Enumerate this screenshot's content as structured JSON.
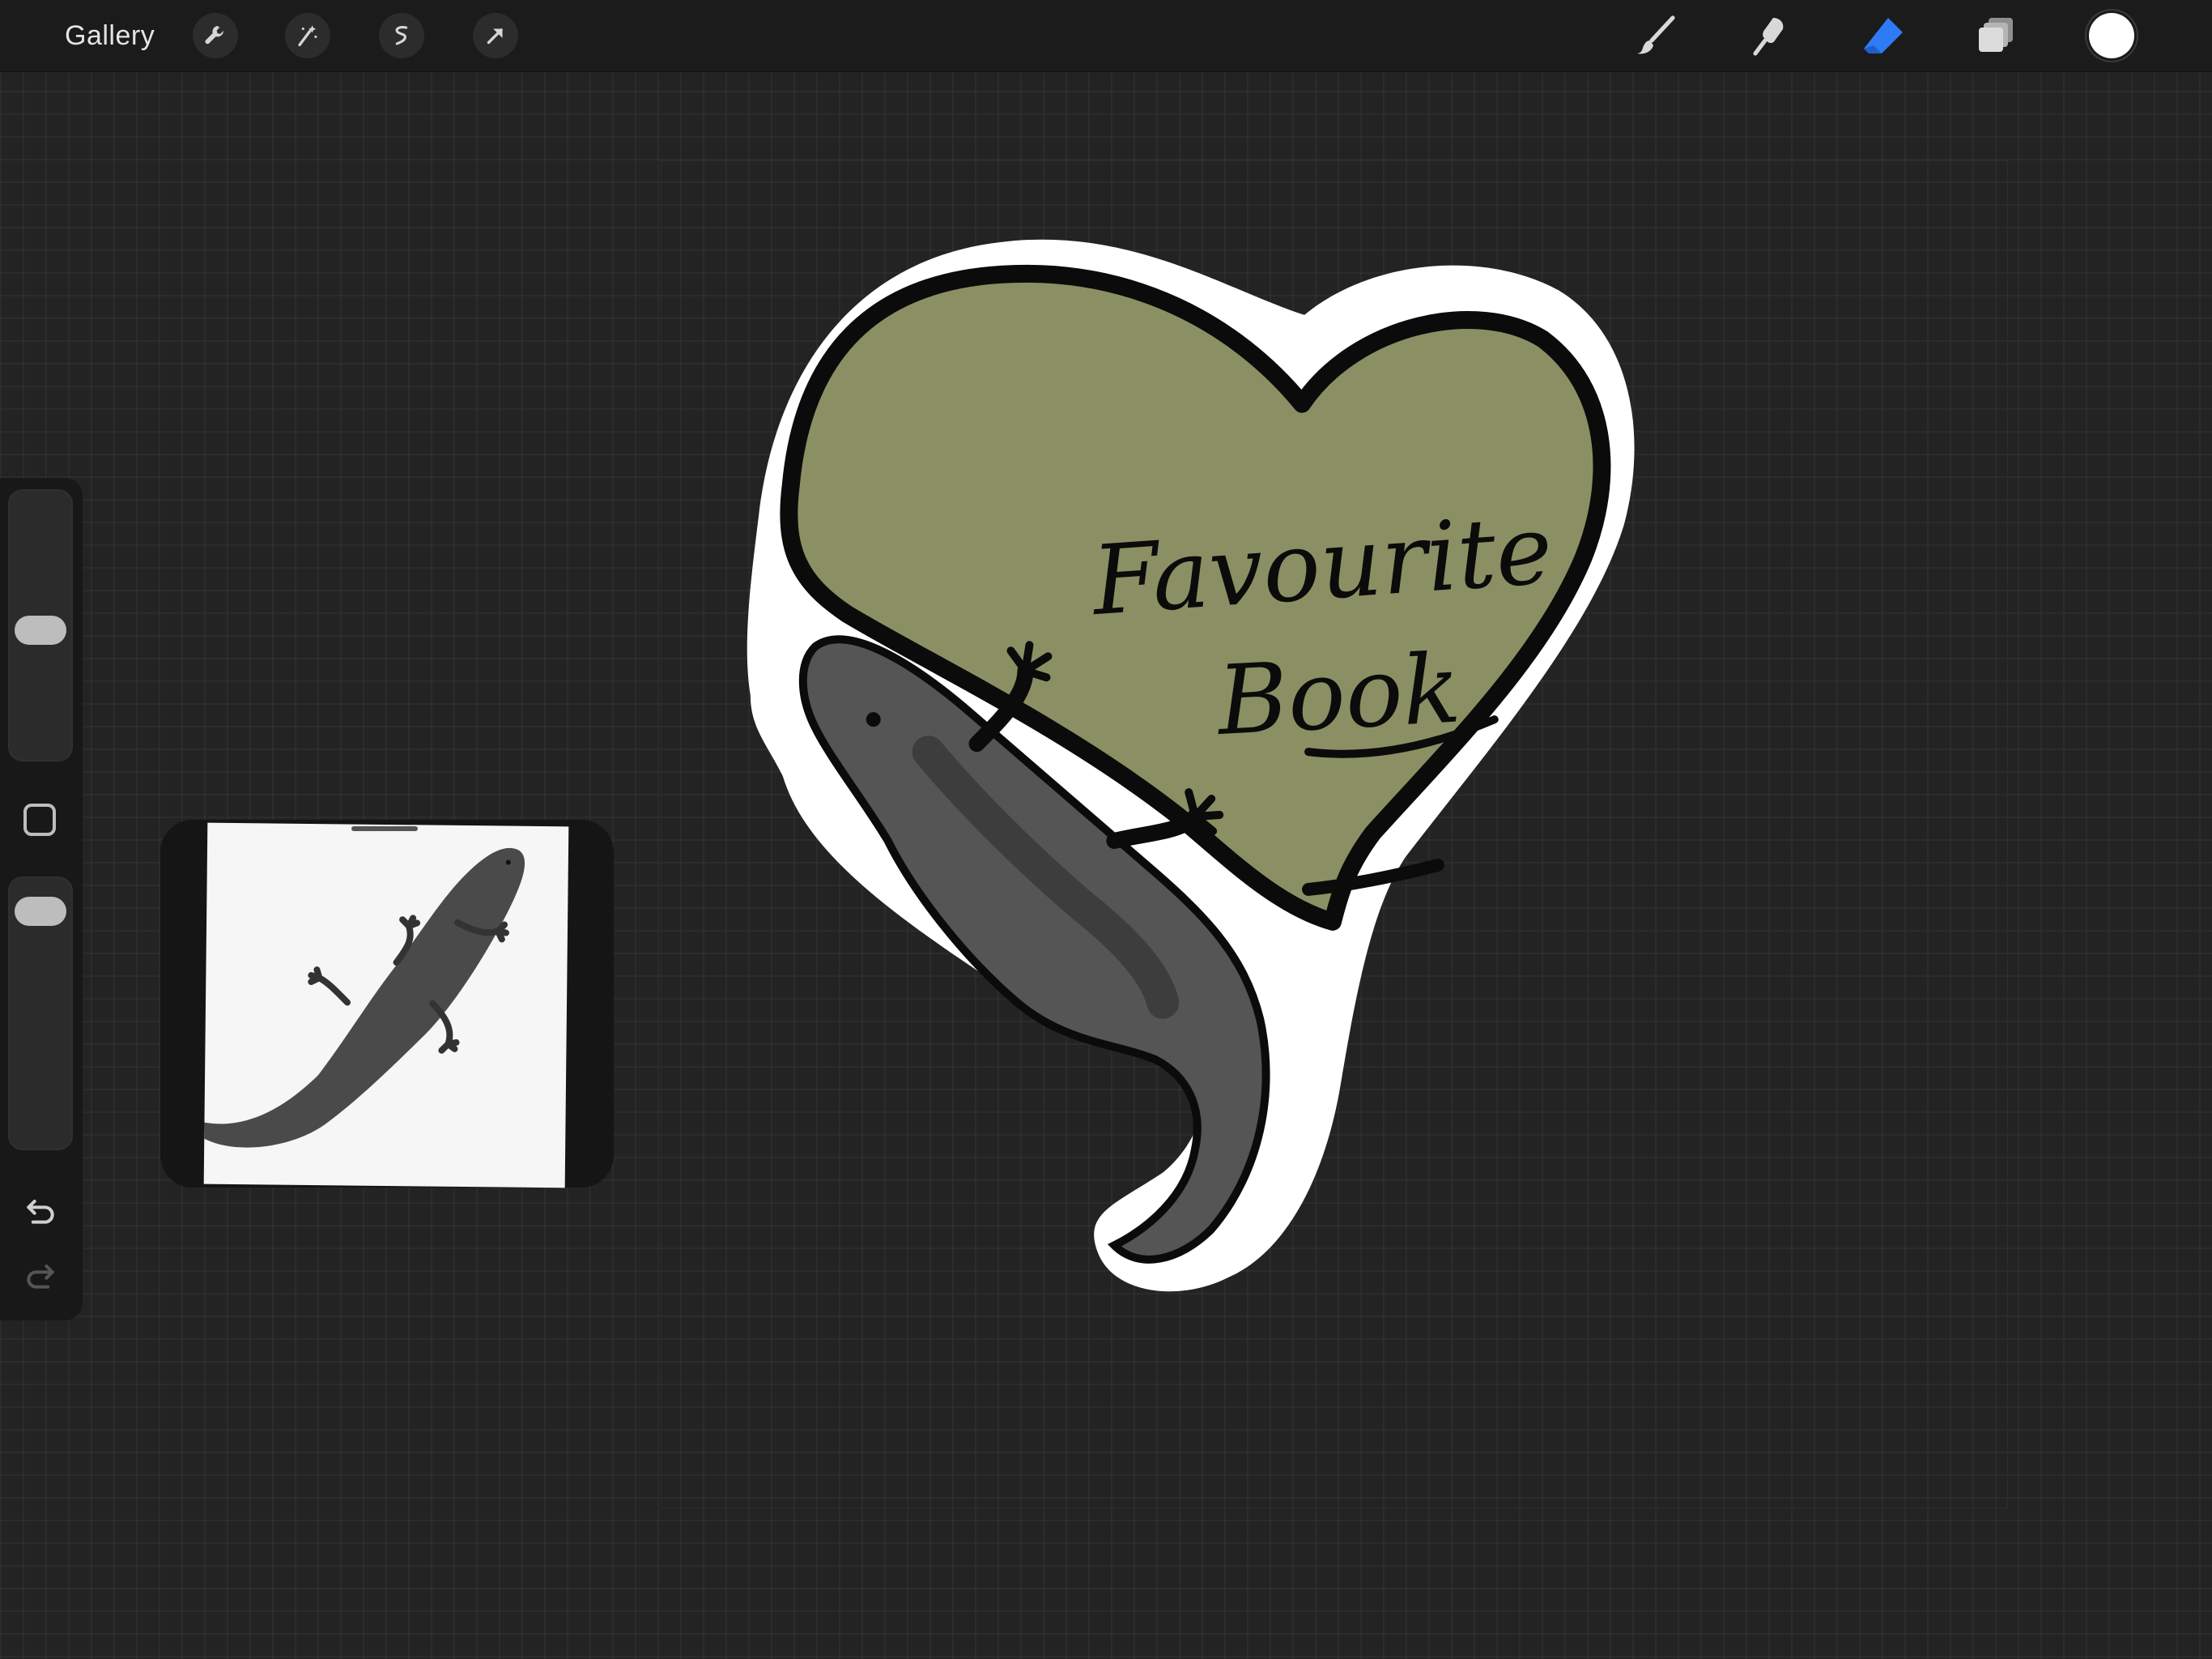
{
  "toolbar": {
    "gallery_label": "Gallery",
    "left_tools": [
      "wrench-icon",
      "magic-wand-icon",
      "selection-icon",
      "transform-arrow-icon"
    ],
    "right_tools": [
      "brush-icon",
      "smudge-icon",
      "eraser-icon",
      "layers-icon"
    ],
    "active_tool": "eraser",
    "accent_color": "#2f7bf5",
    "current_color": "#ffffff"
  },
  "sidebar": {
    "brush_size": 0.48,
    "opacity": 0.94,
    "buttons": [
      "modify-icon",
      "undo-icon",
      "redo-icon"
    ]
  },
  "reference_window": {
    "label": "reference-image",
    "subject": "salamander"
  },
  "canvas": {
    "sticker_fill_color": "#8a9063",
    "outline_color": "#0b0b0b",
    "border_color": "#ffffff",
    "line1": "Favourite",
    "line2": "Book"
  }
}
